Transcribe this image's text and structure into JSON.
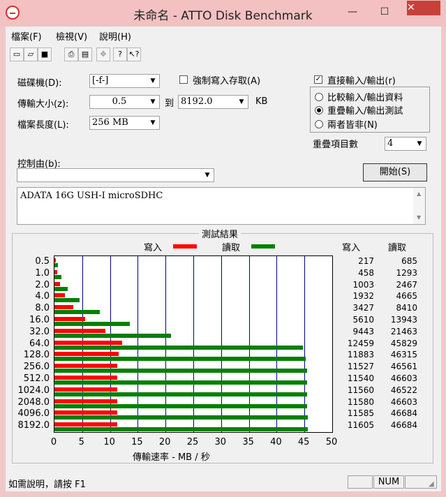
{
  "window": {
    "title": "未命名 - ATTO Disk Benchmark",
    "minimize": "—",
    "maximize": "☐",
    "close": "✕"
  },
  "menu": [
    "檔案(F)",
    "檢視(V)",
    "說明(H)"
  ],
  "toolbar": [
    "new-icon",
    "open-icon",
    "save-icon",
    "print-icon",
    "print-preview-icon",
    "move-icon",
    "help-icon",
    "context-help-icon"
  ],
  "settings": {
    "drive_label": "磁碟機(D):",
    "drive_value": "[-f-]",
    "force_write_label": "強制寫入存取(A)",
    "force_write_checked": false,
    "direct_io_label": "直接輸入/輸出(r)",
    "direct_io_checked": true,
    "transfer_label": "傳輸大小(z):",
    "transfer_from": "0.5",
    "to_label": "到",
    "transfer_to": "8192.0",
    "unit": "KB",
    "length_label": "檔案長度(L):",
    "length_value": "256 MB",
    "radio_compare": "比較輸入/輸出資料",
    "radio_overlap": "重疊輸入/輸出測試",
    "radio_neither": "兩者皆非(N)",
    "radio_selected": "overlap",
    "queue_label": "重疊項目數",
    "queue_value": "4",
    "control_label": "控制由(b):",
    "control_value": "",
    "start_label": "開始(S)",
    "description": "ADATA 16G USH-I microSDHC"
  },
  "results": {
    "title": "測試結果",
    "legend_write": "寫入",
    "legend_read": "讀取",
    "col_write": "寫入",
    "col_read": "讀取",
    "xlabel": "傳輸速率 - MB / 秒",
    "write_color": "#ff0000",
    "read_color": "#008000"
  },
  "chart_data": {
    "type": "bar",
    "orientation": "horizontal",
    "categories": [
      "0.5",
      "1.0",
      "2.0",
      "4.0",
      "8.0",
      "16.0",
      "32.0",
      "64.0",
      "128.0",
      "256.0",
      "512.0",
      "1024.0",
      "2048.0",
      "4096.0",
      "8192.0"
    ],
    "series": [
      {
        "name": "寫入",
        "values": [
          217,
          458,
          1003,
          1932,
          3427,
          5610,
          9443,
          12459,
          11883,
          11527,
          11540,
          11560,
          11580,
          11585,
          11605
        ]
      },
      {
        "name": "讀取",
        "values": [
          685,
          1293,
          2467,
          4665,
          8410,
          13943,
          21463,
          45829,
          46315,
          46561,
          46603,
          46522,
          46603,
          46684,
          46684
        ]
      }
    ],
    "xlabel": "傳輸速率 - MB / 秒",
    "xlim": [
      0,
      50
    ],
    "xticks": [
      0,
      5,
      10,
      15,
      20,
      25,
      30,
      35,
      40,
      45,
      50
    ],
    "grid": true,
    "legend": "top"
  },
  "status": {
    "hint": "如需說明，請按 F1",
    "num": "NUM"
  }
}
